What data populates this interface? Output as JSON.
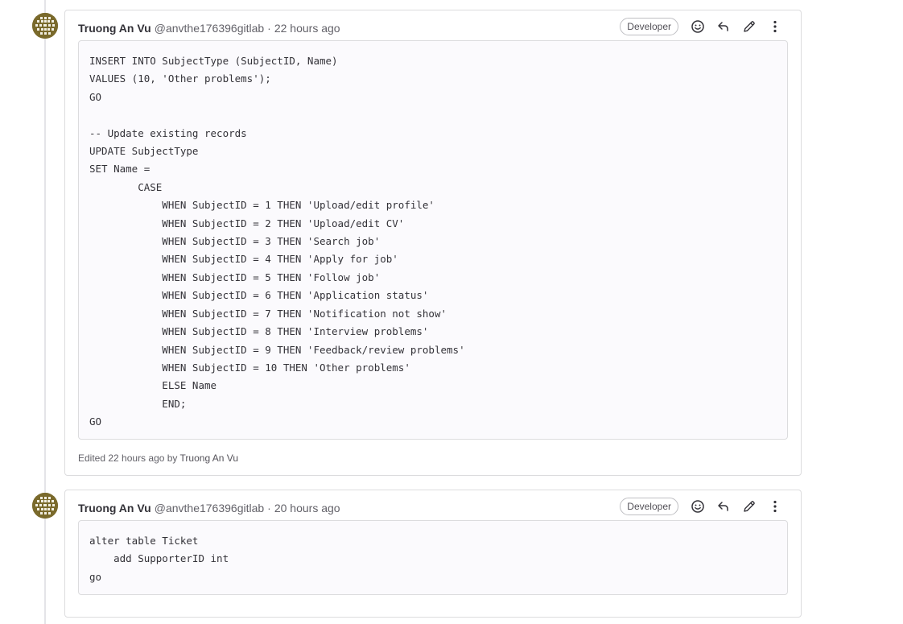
{
  "notes": [
    {
      "author": "Truong An Vu",
      "handle": "@anvthe176396gitlab",
      "separator": "·",
      "time": "22 hours ago",
      "role": "Developer",
      "code": "INSERT INTO SubjectType (SubjectID, Name)\nVALUES (10, 'Other problems');\nGO\n\n-- Update existing records\nUPDATE SubjectType\nSET Name =\n        CASE\n            WHEN SubjectID = 1 THEN 'Upload/edit profile'\n            WHEN SubjectID = 2 THEN 'Upload/edit CV'\n            WHEN SubjectID = 3 THEN 'Search job'\n            WHEN SubjectID = 4 THEN 'Apply for job'\n            WHEN SubjectID = 5 THEN 'Follow job'\n            WHEN SubjectID = 6 THEN 'Application status'\n            WHEN SubjectID = 7 THEN 'Notification not show'\n            WHEN SubjectID = 8 THEN 'Interview problems'\n            WHEN SubjectID = 9 THEN 'Feedback/review problems'\n            WHEN SubjectID = 10 THEN 'Other problems'\n            ELSE Name\n            END;\nGO",
      "edited_prefix": "Edited 22 hours ago by",
      "edited_by": "Truong An Vu"
    },
    {
      "author": "Truong An Vu",
      "handle": "@anvthe176396gitlab",
      "separator": "·",
      "time": "20 hours ago",
      "role": "Developer",
      "code": "alter table Ticket\n    add SupporterID int\ngo"
    }
  ],
  "icons": {
    "emoji": "smiley-icon",
    "reply": "reply-icon",
    "edit": "pencil-icon",
    "more": "kebab-menu-icon"
  },
  "colors": {
    "avatar": "#7a6a2c",
    "border": "#dcdcde",
    "code_bg": "#fbfafd",
    "muted_text": "#626168"
  }
}
